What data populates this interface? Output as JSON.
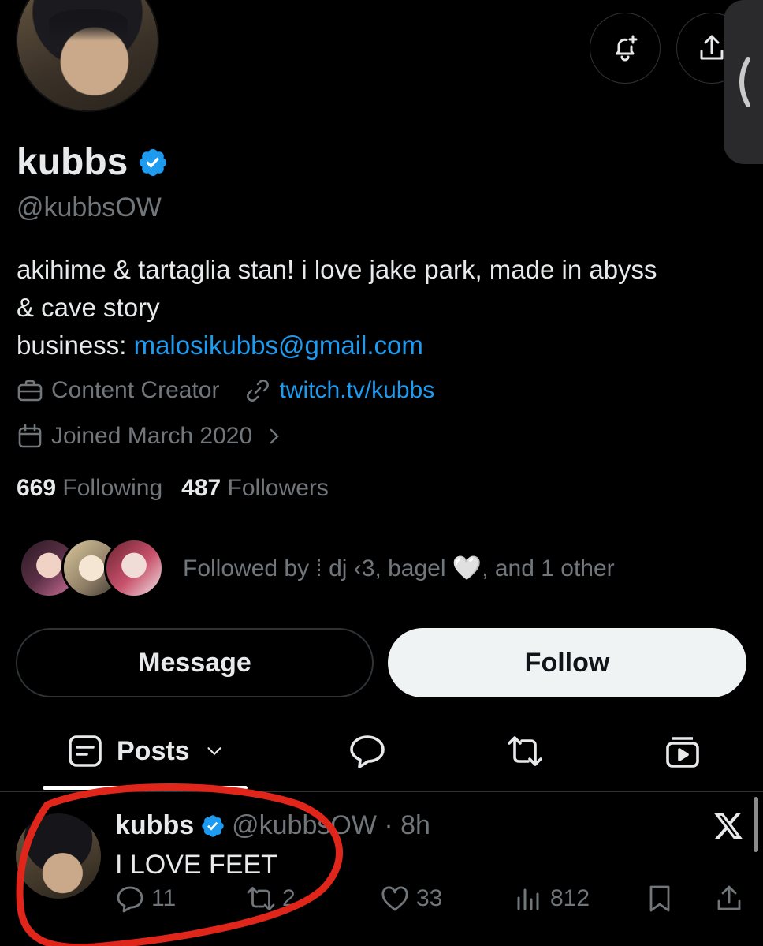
{
  "profile": {
    "display_name": "kubbs",
    "handle": "@kubbsOW",
    "bio_line1": "akihime & tartaglia stan! i love jake park, made in abyss",
    "bio_line2": "& cave story",
    "bio_business_label": "business: ",
    "bio_email": "malosikubbs@gmail.com",
    "category": "Content Creator",
    "website": "twitch.tv/kubbs",
    "joined": "Joined March 2020",
    "following_count": "669",
    "following_label": "Following",
    "followers_count": "487",
    "followers_label": "Followers",
    "followed_by": "Followed by ⁞ dj ‹3, bagel 🤍, and 1 other"
  },
  "buttons": {
    "message": "Message",
    "follow": "Follow"
  },
  "tabs": {
    "posts": "Posts"
  },
  "post": {
    "author": "kubbs",
    "handle_time": "@kubbsOW · 8h",
    "text": "I LOVE FEET",
    "replies": "11",
    "reposts": "2",
    "likes": "33",
    "views": "812"
  },
  "colors": {
    "accent": "#1d9bf0",
    "muted": "#71767b",
    "annotation": "#e0251b"
  },
  "icons": [
    "bell-plus-icon",
    "share-icon",
    "chevron-left-icon",
    "verified-badge-icon",
    "briefcase-icon",
    "link-icon",
    "calendar-icon",
    "chevron-right-icon",
    "posts-icon",
    "chevron-down-icon",
    "reply-icon",
    "repost-icon",
    "media-icon",
    "x-logo-icon",
    "like-icon",
    "views-icon",
    "bookmark-icon"
  ]
}
